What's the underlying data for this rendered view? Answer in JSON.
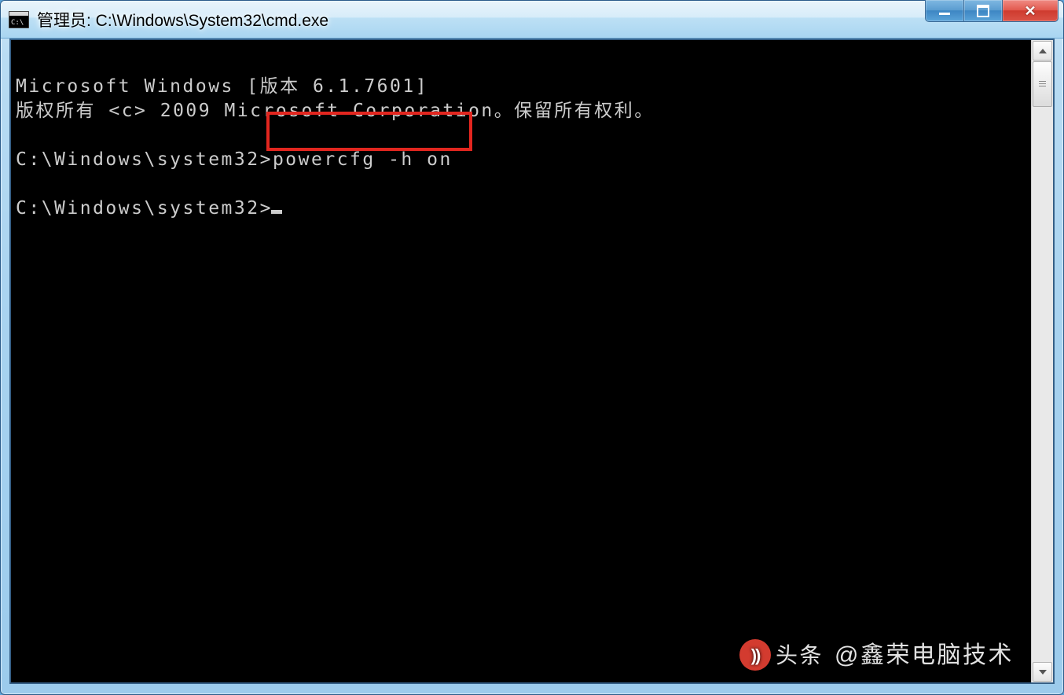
{
  "window": {
    "title": "管理员: C:\\Windows\\System32\\cmd.exe"
  },
  "console": {
    "line1": "Microsoft Windows [版本 6.1.7601]",
    "line2": "版权所有 <c> 2009 Microsoft Corporation。保留所有权利。",
    "prompt1_path": "C:\\Windows\\system32>",
    "prompt1_cmd": "powercfg -h on",
    "prompt2_path": "C:\\Windows\\system32>"
  },
  "watermark": {
    "badge_text": "头条",
    "handle": "@鑫荣电脑技术"
  }
}
